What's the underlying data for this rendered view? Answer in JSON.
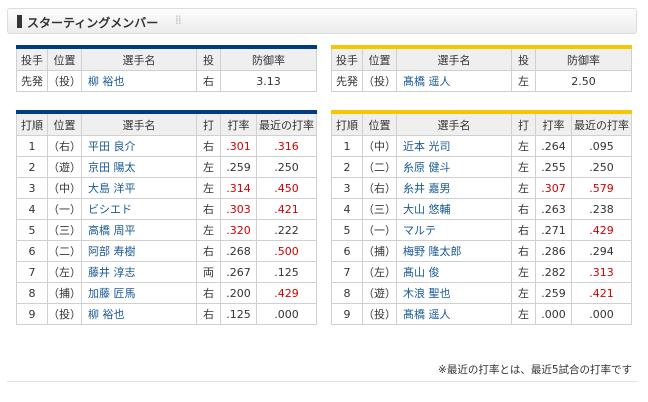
{
  "header": {
    "title": "スターティングメンバー",
    "dots": "⁞⁞"
  },
  "pitch_head": [
    "投手",
    "位置",
    "選手名",
    "投",
    "防御率"
  ],
  "pitch_left": [
    "先発",
    "（投）",
    "柳 裕也",
    "右",
    "3.13"
  ],
  "pitch_right": [
    "先発",
    "（投）",
    "髙橋 遥人",
    "左",
    "2.50"
  ],
  "bat_head": [
    "打順",
    "位置",
    "選手名",
    "打",
    "打率",
    "最近の打率"
  ],
  "left_rows": [
    [
      "1",
      "（右）",
      "平田 良介",
      "右",
      "301",
      "316"
    ],
    [
      "2",
      "（遊）",
      "京田 陽太",
      "左",
      "259",
      "250"
    ],
    [
      "3",
      "（中）",
      "大島 洋平",
      "左",
      "314",
      "450"
    ],
    [
      "4",
      "（一）",
      "ビシエド",
      "右",
      "303",
      "421"
    ],
    [
      "5",
      "（三）",
      "高橋 周平",
      "左",
      "320",
      "222"
    ],
    [
      "6",
      "（二）",
      "阿部 寿樹",
      "右",
      "268",
      "500"
    ],
    [
      "7",
      "（左）",
      "藤井 淳志",
      "両",
      "267",
      "125"
    ],
    [
      "8",
      "（捕）",
      "加藤 匠馬",
      "右",
      "200",
      "429"
    ],
    [
      "9",
      "（投）",
      "柳 裕也",
      "右",
      "125",
      "000"
    ]
  ],
  "left_red": [
    [
      true,
      true
    ],
    [
      false,
      false
    ],
    [
      true,
      true
    ],
    [
      true,
      true
    ],
    [
      true,
      false
    ],
    [
      false,
      true
    ],
    [
      false,
      false
    ],
    [
      false,
      true
    ],
    [
      false,
      false
    ]
  ],
  "right_rows": [
    [
      "1",
      "（中）",
      "近本 光司",
      "左",
      "264",
      "095"
    ],
    [
      "2",
      "（二）",
      "糸原 健斗",
      "左",
      "255",
      "250"
    ],
    [
      "3",
      "（右）",
      "糸井 嘉男",
      "左",
      "307",
      "579"
    ],
    [
      "4",
      "（三）",
      "大山 悠輔",
      "右",
      "263",
      "238"
    ],
    [
      "5",
      "（一）",
      "マルテ",
      "右",
      "271",
      "429"
    ],
    [
      "6",
      "（捕）",
      "梅野 隆太郎",
      "右",
      "286",
      "294"
    ],
    [
      "7",
      "（左）",
      "髙山 俊",
      "左",
      "282",
      "313"
    ],
    [
      "8",
      "（遊）",
      "木浪 聖也",
      "左",
      "259",
      "421"
    ],
    [
      "9",
      "（投）",
      "髙橋 遥人",
      "左",
      "000",
      "000"
    ]
  ],
  "right_red": [
    [
      false,
      false
    ],
    [
      false,
      false
    ],
    [
      true,
      true
    ],
    [
      false,
      false
    ],
    [
      false,
      true
    ],
    [
      false,
      false
    ],
    [
      false,
      true
    ],
    [
      false,
      true
    ],
    [
      false,
      false
    ]
  ],
  "note": "※最近の打率とは、最近5試合の打率です",
  "colors": {
    "central_team": "#003b82",
    "tigers": "#f7c600",
    "highlight": "#d40000"
  }
}
